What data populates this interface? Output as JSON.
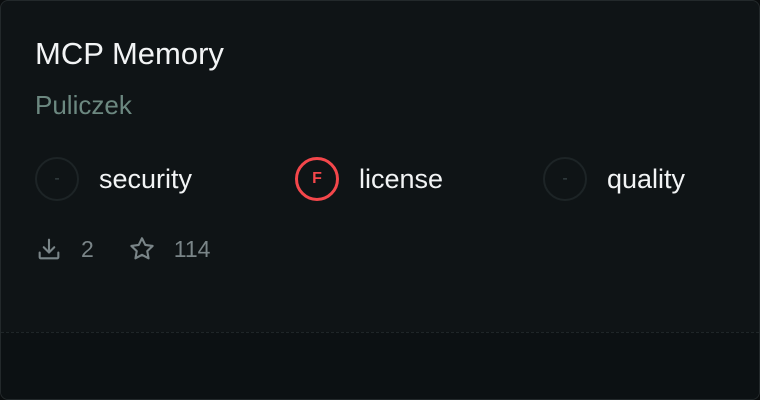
{
  "card": {
    "title": "MCP Memory",
    "author": "Puliczek",
    "scores": [
      {
        "name": "security",
        "grade": "-",
        "status": "none"
      },
      {
        "name": "license",
        "grade": "F",
        "status": "fail",
        "color": "#f4474b"
      },
      {
        "name": "quality",
        "grade": "-",
        "status": "none"
      }
    ],
    "stats": {
      "downloads": "2",
      "downloads_icon": "download-icon",
      "stars": "114",
      "stars_icon": "star-icon"
    }
  }
}
